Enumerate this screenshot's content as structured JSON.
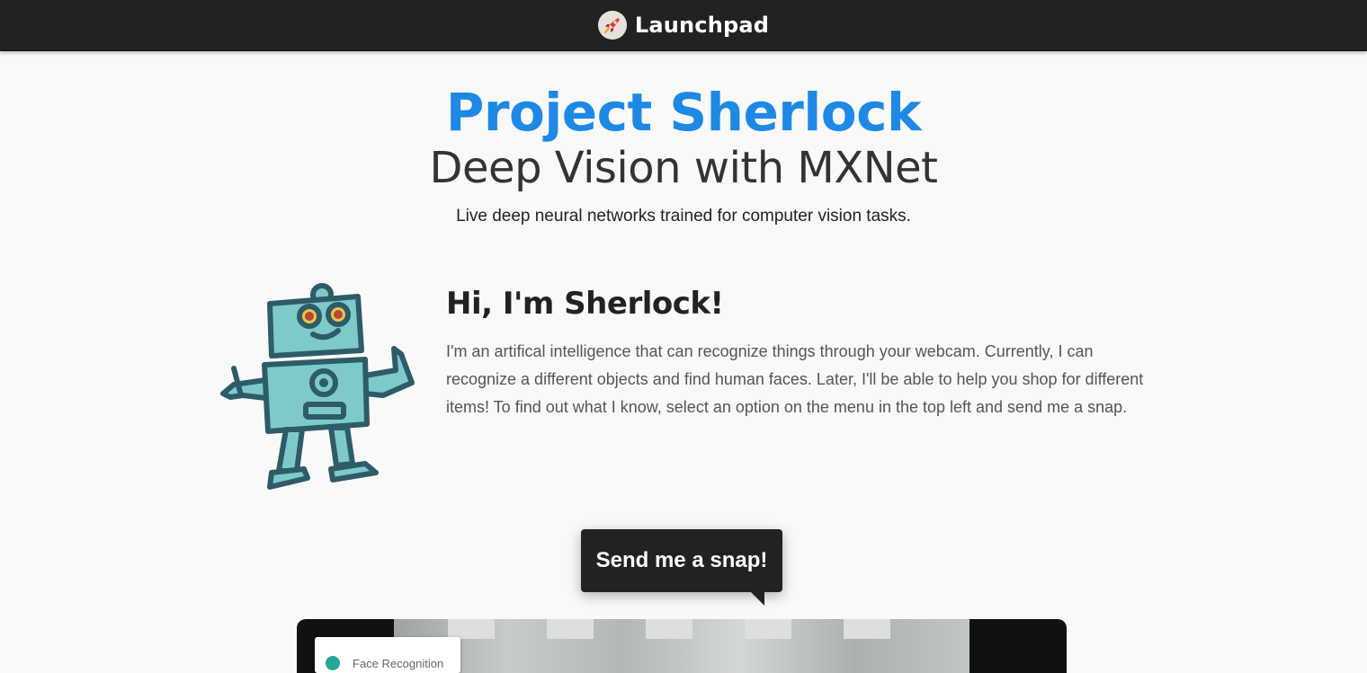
{
  "app": {
    "name": "Launchpad",
    "logo_icon": "rocket-icon"
  },
  "hero": {
    "title": "Project Sherlock",
    "subtitle": "Deep Vision with MXNet",
    "description": "Live deep neural networks trained for computer vision tasks."
  },
  "intro": {
    "heading": "Hi, I'm Sherlock!",
    "body": "I'm an artifical intelligence that can recognize things through your webcam. Currently, I can recognize a different objects and find human faces. Later, I'll be able to help you shop for different items! To find out what I know, select an option on the menu in the top left and send me a snap.",
    "mascot_icon": "robot-icon"
  },
  "bubble": {
    "label": "Send me a snap!"
  },
  "camera": {
    "menu_label": "Face Recognition"
  },
  "colors": {
    "accent": "#1e88e5",
    "topbar": "#222222",
    "teal": "#26a69a",
    "robot_body": "#7ecac9",
    "robot_outline": "#2d5c68"
  }
}
